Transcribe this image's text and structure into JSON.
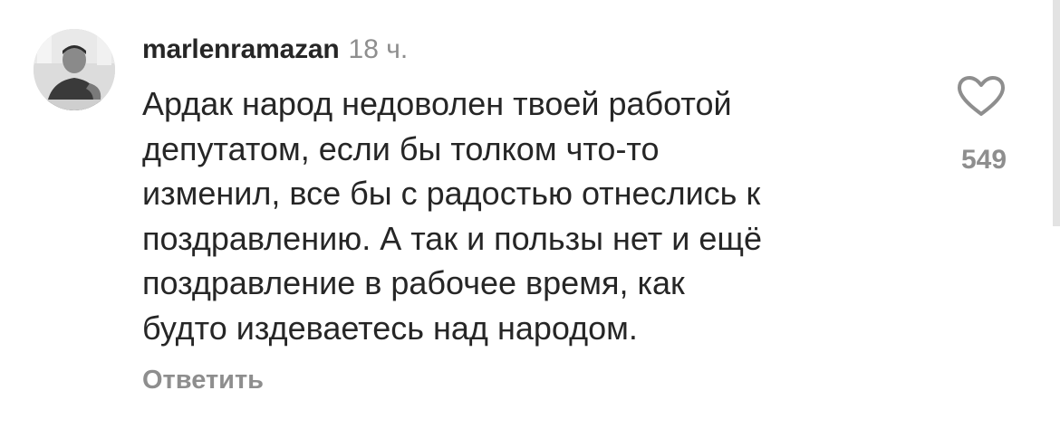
{
  "comment": {
    "avatar_icon": "user-photo",
    "username": "marlenramazan",
    "time": "18 ч.",
    "text": "Ардак народ недоволен твоей работой\nдепутатом, если бы толком что-то\nизменил, все бы с радостью отнеслись к\nпоздравлению. А так и пользы нет и ещё\nпоздравление в рабочее время, как\nбудто издеваетесь над народом.",
    "reply_label": "Ответить",
    "like_icon": "heart-outline",
    "like_count": "549"
  }
}
